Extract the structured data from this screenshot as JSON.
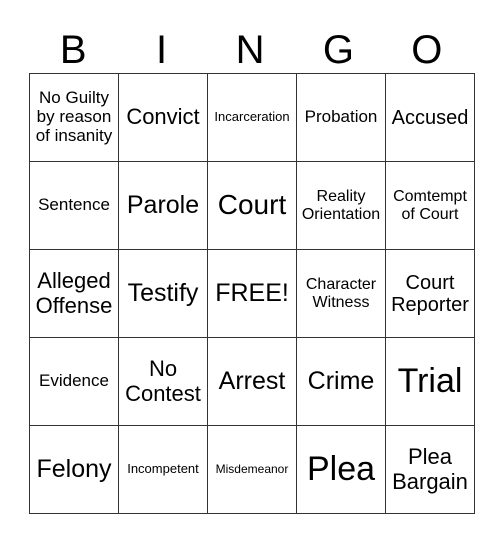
{
  "header": [
    "B",
    "I",
    "N",
    "G",
    "O"
  ],
  "cells": [
    [
      "No Guilty by reason of insanity",
      "Convict",
      "Incarceration",
      "Probation",
      "Accused"
    ],
    [
      "Sentence",
      "Parole",
      "Court",
      "Reality Orientation",
      "Comtempt of Court"
    ],
    [
      "Alleged Offense",
      "Testify",
      "FREE!",
      "Character Witness",
      "Court Reporter"
    ],
    [
      "Evidence",
      "No Contest",
      "Arrest",
      "Crime",
      "Trial"
    ],
    [
      "Felony",
      "Incompetent",
      "Misdemeanor",
      "Plea",
      "Plea Bargain"
    ]
  ]
}
